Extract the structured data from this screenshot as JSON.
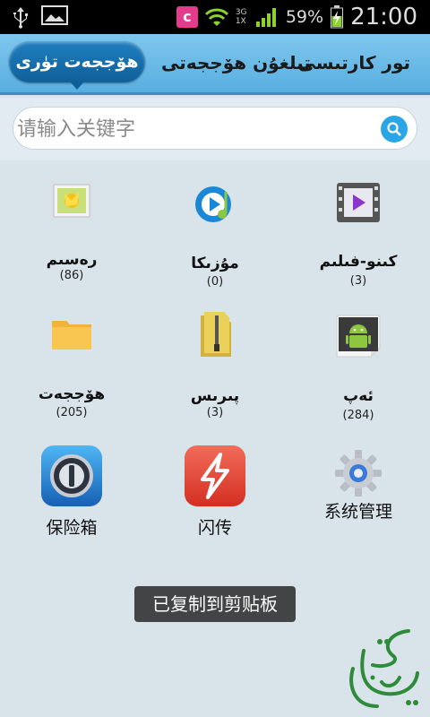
{
  "status": {
    "carrier_icon": "c",
    "network": "3G 1X",
    "battery_pct": "59%",
    "time": "21:00"
  },
  "tabs": {
    "active": "ھۆججەت تۈرى",
    "recent": "تىلغۇن ھۆججەتى",
    "card": "تور كارتىسى"
  },
  "search": {
    "placeholder": "请输入关键字"
  },
  "categories": [
    {
      "label": "رەسىم",
      "count": "(86)"
    },
    {
      "label": "مۇزىكا",
      "count": "(0)"
    },
    {
      "label": "كىنو-فىلىم",
      "count": "(3)"
    },
    {
      "label": "ھۆججەت",
      "count": "(205)"
    },
    {
      "label": "پىرىس",
      "count": "(3)"
    },
    {
      "label": "ئەپ",
      "count": "(284)"
    }
  ],
  "tools": [
    {
      "label": "保险箱"
    },
    {
      "label": "闪传"
    },
    {
      "label": "系统管理"
    }
  ],
  "toast": "已复制到剪贴板",
  "colors": {
    "accent": "#1f7fbf",
    "tab_bar": "#6bbce8",
    "background": "#d9e3ea"
  }
}
